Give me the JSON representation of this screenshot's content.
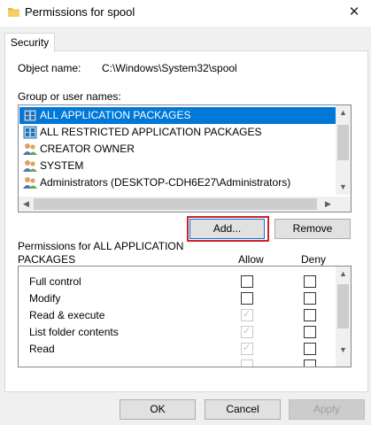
{
  "window": {
    "title": "Permissions for spool"
  },
  "tabs": [
    {
      "label": "Security"
    }
  ],
  "object": {
    "label": "Object name:",
    "value": "C:\\Windows\\System32\\spool"
  },
  "groups": {
    "label": "Group or user names:",
    "items": [
      {
        "label": "ALL APPLICATION PACKAGES",
        "icon": "package-icon",
        "selected": true
      },
      {
        "label": "ALL RESTRICTED APPLICATION PACKAGES",
        "icon": "package-icon",
        "selected": false
      },
      {
        "label": "CREATOR OWNER",
        "icon": "users-icon",
        "selected": false
      },
      {
        "label": "SYSTEM",
        "icon": "users-icon",
        "selected": false
      },
      {
        "label": "Administrators (DESKTOP-CDH6E27\\Administrators)",
        "icon": "users-icon",
        "selected": false
      }
    ]
  },
  "buttons": {
    "add": "Add...",
    "remove": "Remove",
    "ok": "OK",
    "cancel": "Cancel",
    "apply": "Apply"
  },
  "permissions": {
    "label_line1": "Permissions for ALL APPLICATION",
    "label_line2": "PACKAGES",
    "allow_header": "Allow",
    "deny_header": "Deny",
    "rows": [
      {
        "label": "Full control",
        "allow": false,
        "allow_disabled": false,
        "deny": false
      },
      {
        "label": "Modify",
        "allow": false,
        "allow_disabled": false,
        "deny": false
      },
      {
        "label": "Read & execute",
        "allow": true,
        "allow_disabled": true,
        "deny": false
      },
      {
        "label": "List folder contents",
        "allow": true,
        "allow_disabled": true,
        "deny": false
      },
      {
        "label": "Read",
        "allow": true,
        "allow_disabled": true,
        "deny": false
      }
    ]
  },
  "colors": {
    "selection": "#0078d7",
    "highlight": "#d4202a",
    "panel": "#f0f0f0"
  }
}
